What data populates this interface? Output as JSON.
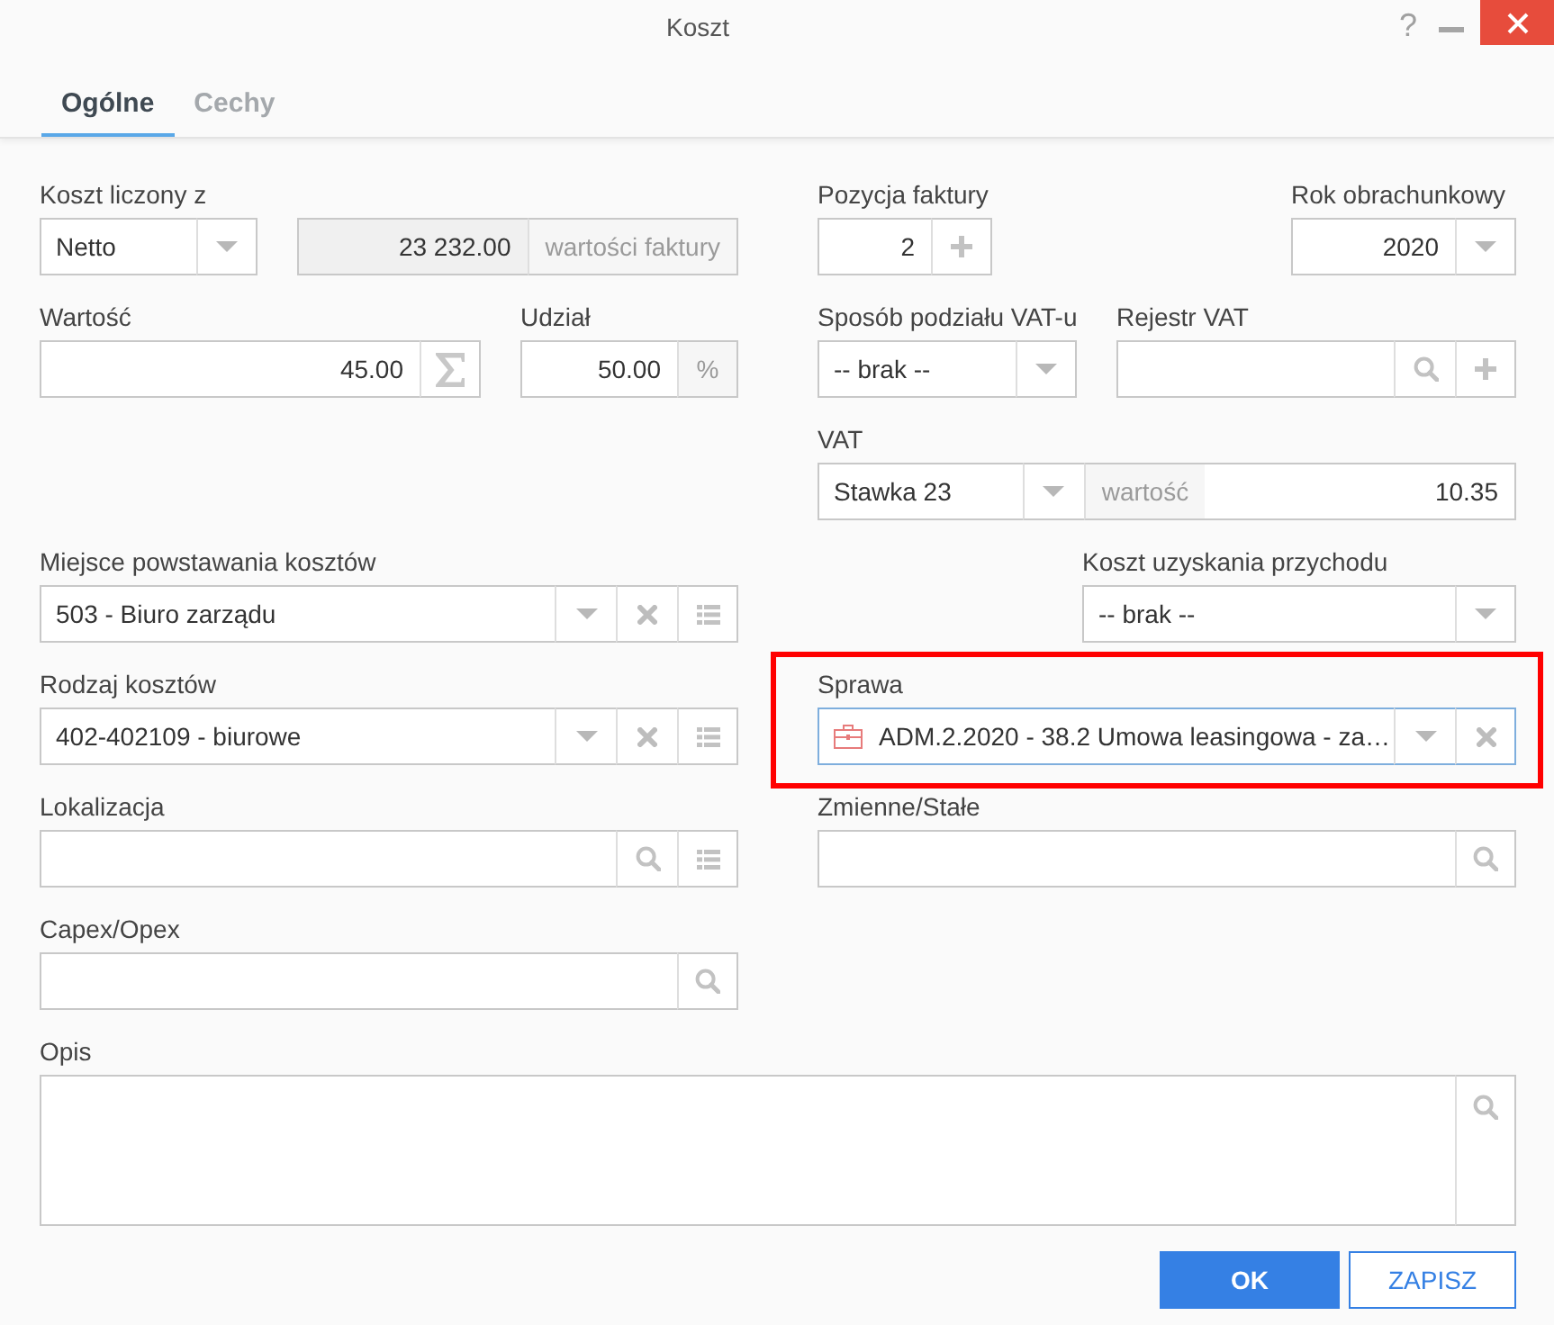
{
  "window": {
    "title": "Koszt",
    "help": "?"
  },
  "tabs": [
    {
      "label": "Ogólne",
      "selected": true
    },
    {
      "label": "Cechy",
      "selected": false
    }
  ],
  "fields": [
    {
      "label": "Koszt liczony z",
      "readonly": false,
      "focused": false,
      "highlighted": false,
      "parts": [
        {
          "kind": "select",
          "value": "Netto"
        },
        {
          "kind": "caret"
        }
      ]
    },
    {
      "readonly": true,
      "focused": false,
      "highlighted": false,
      "parts": [
        {
          "kind": "number",
          "value": "23 232.00"
        },
        {
          "kind": "unit",
          "text": "wartości faktury"
        }
      ]
    },
    {
      "label": "Pozycja faktury",
      "readonly": false,
      "focused": false,
      "highlighted": false,
      "parts": [
        {
          "kind": "number",
          "value": "2"
        },
        {
          "kind": "plus"
        }
      ]
    },
    {
      "label": "Rok obrachunkowy",
      "readonly": false,
      "focused": false,
      "highlighted": false,
      "parts": [
        {
          "kind": "number",
          "value": "2020"
        },
        {
          "kind": "caret"
        }
      ]
    },
    {
      "label": "Wartość",
      "readonly": false,
      "focused": false,
      "highlighted": false,
      "parts": [
        {
          "kind": "number",
          "value": "45.00"
        },
        {
          "kind": "sigma"
        }
      ]
    },
    {
      "label": "Udział",
      "readonly": false,
      "focused": false,
      "highlighted": false,
      "parts": [
        {
          "kind": "number",
          "value": "50.00"
        },
        {
          "kind": "unit",
          "text": "%"
        }
      ]
    },
    {
      "label": "Sposób podziału VAT-u",
      "readonly": false,
      "focused": false,
      "highlighted": false,
      "parts": [
        {
          "kind": "select",
          "value": "-- brak --"
        },
        {
          "kind": "caret"
        }
      ]
    },
    {
      "label": "Rejestr VAT",
      "readonly": false,
      "focused": false,
      "highlighted": false,
      "parts": [
        {
          "kind": "text"
        },
        {
          "kind": "search"
        },
        {
          "kind": "plus"
        }
      ]
    },
    {
      "label": "VAT",
      "readonly": false,
      "focused": false,
      "highlighted": false,
      "parts": [
        {
          "kind": "select",
          "value": "Stawka 23"
        },
        {
          "kind": "caret"
        },
        {
          "kind": "unit",
          "text": "wartość"
        },
        {
          "kind": "number",
          "value": "10.35"
        }
      ]
    },
    {
      "label": "Miejsce powstawania kosztów",
      "readonly": false,
      "focused": false,
      "highlighted": false,
      "parts": [
        {
          "kind": "select",
          "value": "503 - Biuro zarządu"
        },
        {
          "kind": "caret"
        },
        {
          "kind": "clear"
        },
        {
          "kind": "list"
        }
      ]
    },
    {
      "label": "Koszt uzyskania przychodu",
      "readonly": false,
      "focused": false,
      "highlighted": false,
      "parts": [
        {
          "kind": "select",
          "value": "-- brak --"
        },
        {
          "kind": "caret"
        }
      ]
    },
    {
      "label": "Rodzaj kosztów",
      "readonly": false,
      "focused": false,
      "highlighted": false,
      "parts": [
        {
          "kind": "select",
          "value": "402-402109 - biurowe"
        },
        {
          "kind": "caret"
        },
        {
          "kind": "clear"
        },
        {
          "kind": "list"
        }
      ]
    },
    {
      "label": "Sprawa",
      "readonly": false,
      "focused": true,
      "highlighted": true,
      "parts": [
        {
          "kind": "record",
          "value": "ADM.2.2020 - 38.2 Umowa leasingowa - za…"
        },
        {
          "kind": "caret"
        },
        {
          "kind": "clear"
        }
      ]
    },
    {
      "label": "Lokalizacja",
      "readonly": false,
      "focused": false,
      "highlighted": false,
      "parts": [
        {
          "kind": "text"
        },
        {
          "kind": "search"
        },
        {
          "kind": "list"
        }
      ]
    },
    {
      "label": "Zmienne/Stałe",
      "readonly": false,
      "focused": false,
      "highlighted": false,
      "parts": [
        {
          "kind": "text"
        },
        {
          "kind": "search"
        }
      ]
    },
    {
      "label": "Capex/Opex",
      "readonly": false,
      "focused": false,
      "highlighted": false,
      "parts": [
        {
          "kind": "text"
        },
        {
          "kind": "search"
        }
      ]
    },
    {
      "label": "Opis",
      "readonly": false,
      "focused": false,
      "highlighted": false,
      "parts": [
        {
          "kind": "textarea"
        },
        {
          "kind": "search"
        }
      ]
    }
  ],
  "buttons": [
    {
      "label": "OK",
      "kind": "primary"
    },
    {
      "label": "ZAPISZ",
      "kind": "secondary"
    }
  ]
}
